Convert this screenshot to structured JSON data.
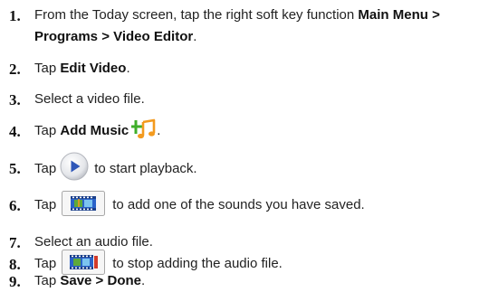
{
  "steps": [
    {
      "num": "1.",
      "pre": "From the Today screen, tap the right soft key function ",
      "bold": "Main Menu > Programs > Video Editor",
      "post": "."
    },
    {
      "num": "2.",
      "pre": "Tap ",
      "bold": "Edit Video",
      "post": "."
    },
    {
      "num": "3.",
      "text": "Select a video file."
    },
    {
      "num": "4.",
      "pre": "Tap ",
      "bold": "Add Music",
      "post": "."
    },
    {
      "num": "5.",
      "pre": "Tap",
      "post": "to start playback."
    },
    {
      "num": "6.",
      "pre": "Tap",
      "post": "to add one of the sounds you have saved."
    },
    {
      "num": "7.",
      "text": "Select an audio file."
    },
    {
      "num": "8.",
      "pre": "Tap",
      "post": "to stop adding the audio file."
    },
    {
      "num": "9.",
      "pre": "Tap ",
      "bold": "Save > Done",
      "post": "."
    }
  ],
  "icons": {
    "add_music": "add-music-icon",
    "play": "play-icon",
    "add_sound": "film-add-sound-icon",
    "stop_audio": "film-stop-audio-icon"
  },
  "colors": {
    "music_plus": "#3fae2a",
    "music_note": "#f39a1e",
    "play_blue": "#2e56b8",
    "film_green": "#5ea93a",
    "film_blue": "#2a62c9",
    "film_red": "#d23a2a"
  }
}
